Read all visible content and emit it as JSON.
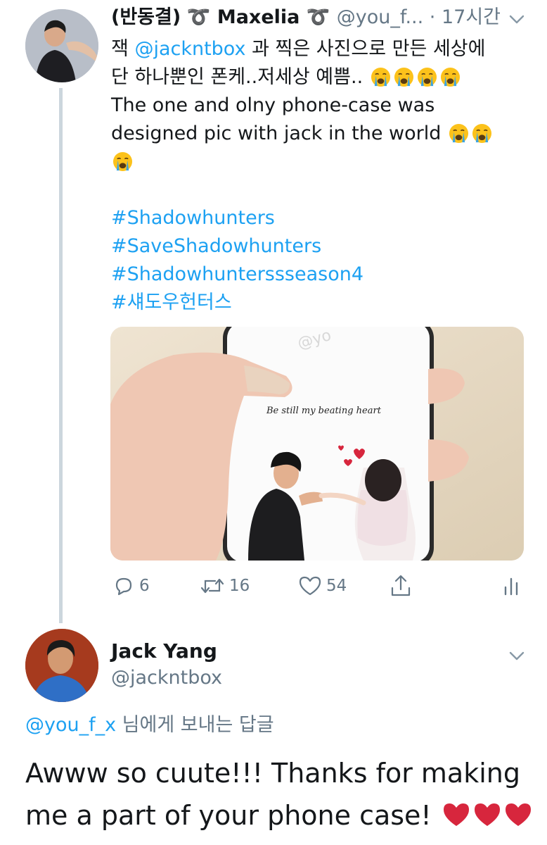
{
  "tweet1": {
    "display_name": "(반동결)",
    "display_name_suffix": "Maxelia",
    "handle": "@you_f...",
    "separator": "·",
    "time": "17시간",
    "text_line1_prefix": "잭 ",
    "text_mention": "@jackntbox",
    "text_line1_suffix": " 과 찍은 사진으로 만든 세상에",
    "text_line2": "단 하나뿐인 폰케..저세상 예쁨..",
    "text_line3": "The one and olny phone-case was",
    "text_line4": "designed pic with jack in the world",
    "hashtags": [
      "#Shadowhunters",
      "#SaveShadowhunters",
      "#Shadowhunterssseason4",
      "#섀도우헌터스"
    ],
    "media": {
      "caption": "Be still my beating heart",
      "watermark": "@yo"
    },
    "actions": {
      "replies": "6",
      "retweets": "16",
      "likes": "54"
    },
    "icons": [
      "reply-icon",
      "retweet-icon",
      "like-icon",
      "share-icon",
      "analytics-icon",
      "chevron-down-icon"
    ]
  },
  "tweet2": {
    "display_name": "Jack Yang",
    "handle": "@jackntbox",
    "reply_mention": "@you_f_x",
    "reply_suffix": " 님에게 보내는 답글",
    "text": "Awww so cuute!!! Thanks for making me a part of your phone case!"
  },
  "colors": {
    "link": "#1da1f2",
    "secondary": "#657786",
    "thread_line": "#ccd6dd",
    "emoji_face": "#fcc21b",
    "heart": "#d7263d"
  }
}
